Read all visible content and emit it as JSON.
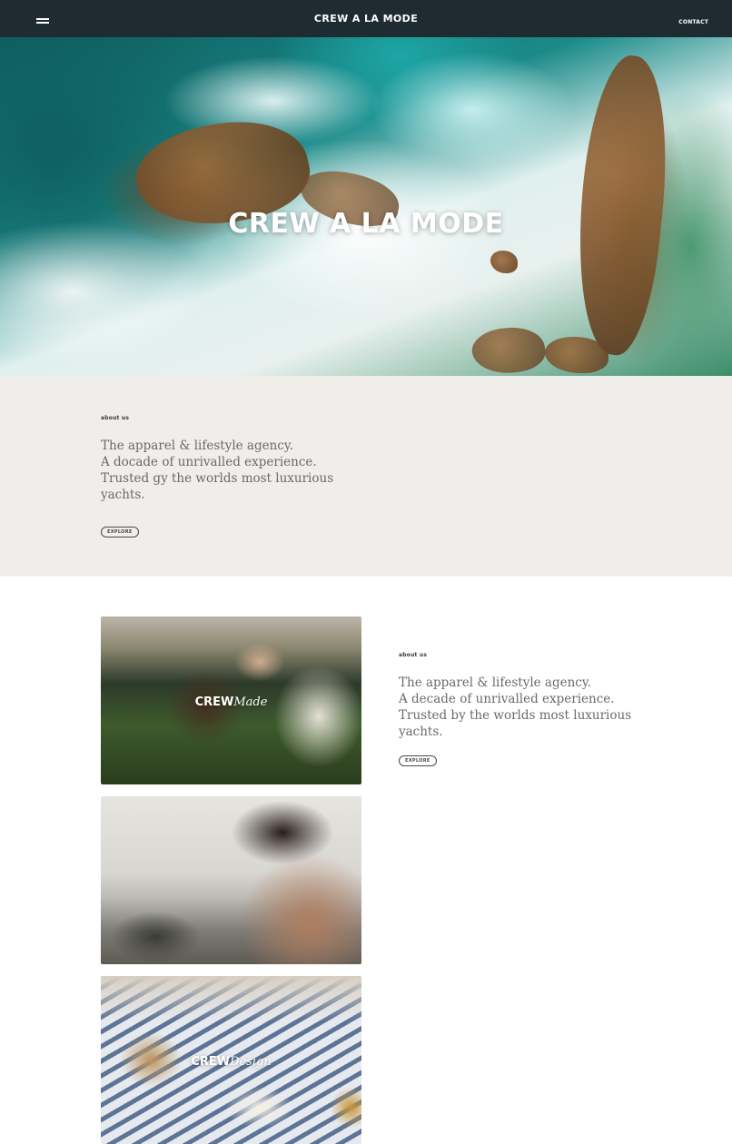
{
  "header": {
    "brand": "CREW A LA MODE",
    "contact_label": "CONTACT",
    "menu_icon": "hamburger-icon"
  },
  "hero": {
    "title": "CREW A LA MODE"
  },
  "about": {
    "eyebrow": "about us",
    "lines": [
      "The apparel & lifestyle agency.",
      "A docade of unrivalled experience.",
      "Trusted gy the worlds most luxurious",
      "yachts."
    ],
    "button_label": "EXPLORE"
  },
  "cards": [
    {
      "name_strong": "CREW",
      "name_script": "Made"
    },
    {
      "name_strong": "",
      "name_script": ""
    },
    {
      "name_strong": "CREW",
      "name_script": "Design"
    }
  ],
  "side": {
    "eyebrow": "about us",
    "lines": [
      "The apparel & lifestyle agency.",
      "A decade of unrivalled experience.",
      "Trusted by the worlds most luxurious",
      "yachts."
    ],
    "button_label": "EXPLORE"
  }
}
